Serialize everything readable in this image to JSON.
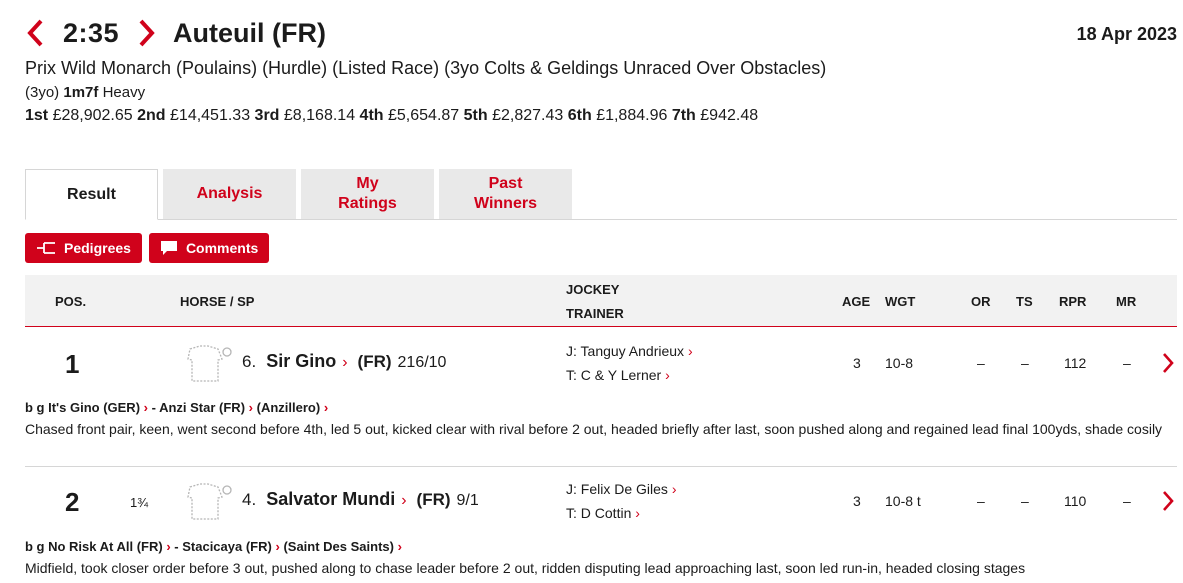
{
  "header": {
    "time": "2:35",
    "course": "Auteuil (FR)",
    "date": "18 Apr 2023",
    "race_title": "Prix Wild Monarch (Poulains) (Hurdle) (Listed Race) (3yo Colts & Geldings Unraced Over Obstacles)",
    "age_cond": "(3yo)",
    "distance": "1m7f",
    "going": "Heavy",
    "prizes": [
      {
        "place": "1st",
        "amount": "£28,902.65"
      },
      {
        "place": "2nd",
        "amount": "£14,451.33"
      },
      {
        "place": "3rd",
        "amount": "£8,168.14"
      },
      {
        "place": "4th",
        "amount": "£5,654.87"
      },
      {
        "place": "5th",
        "amount": "£2,827.43"
      },
      {
        "place": "6th",
        "amount": "£1,884.96"
      },
      {
        "place": "7th",
        "amount": "£942.48"
      }
    ]
  },
  "tabs": [
    {
      "label": "Result"
    },
    {
      "label": "Analysis"
    },
    {
      "label": "My Ratings"
    },
    {
      "label": "Past Winners"
    }
  ],
  "buttons": {
    "pedigrees": "Pedigrees",
    "comments": "Comments"
  },
  "table": {
    "headers": {
      "pos": "POS.",
      "horse": "HORSE / SP",
      "jockey": "JOCKEY",
      "trainer": "TRAINER",
      "age": "AGE",
      "wgt": "WGT",
      "or": "OR",
      "ts": "TS",
      "rpr": "RPR",
      "mr": "MR"
    },
    "rows": [
      {
        "pos": "1",
        "dist": "",
        "number": "6.",
        "horse": "Sir Gino",
        "country": "(FR)",
        "sp": "216/10",
        "jockey": "J: Tanguy Andrieux",
        "trainer": "T: C & Y Lerner",
        "age": "3",
        "wgt": "10-8",
        "or": "–",
        "ts": "–",
        "rpr": "112",
        "mr": "–",
        "pedigree": [
          "b g It's Gino (GER)",
          "- Anzi Star (FR)",
          "(Anzillero)"
        ],
        "comment": "Chased front pair, keen, went second before 4th, led 5 out, kicked clear with rival before 2 out, headed briefly after last, soon pushed along and regained lead final 100yds, shade cosily"
      },
      {
        "pos": "2",
        "dist": "1¾",
        "number": "4.",
        "horse": "Salvator Mundi",
        "country": "(FR)",
        "sp": "9/1",
        "jockey": "J: Felix De Giles",
        "trainer": "T: D Cottin",
        "age": "3",
        "wgt": "10-8 t",
        "or": "–",
        "ts": "–",
        "rpr": "110",
        "mr": "–",
        "pedigree": [
          "b g No Risk At All (FR)",
          "- Stacicaya (FR)",
          "(Saint Des Saints)"
        ],
        "comment": "Midfield, took closer order before 3 out, pushed along to chase leader before 2 out, ridden disputing lead approaching last, soon led run-in, headed closing stages"
      }
    ]
  },
  "colors": {
    "accent": "#d0021b",
    "header_bg": "#f2f2f2",
    "tab_bg": "#e9e9e9"
  }
}
